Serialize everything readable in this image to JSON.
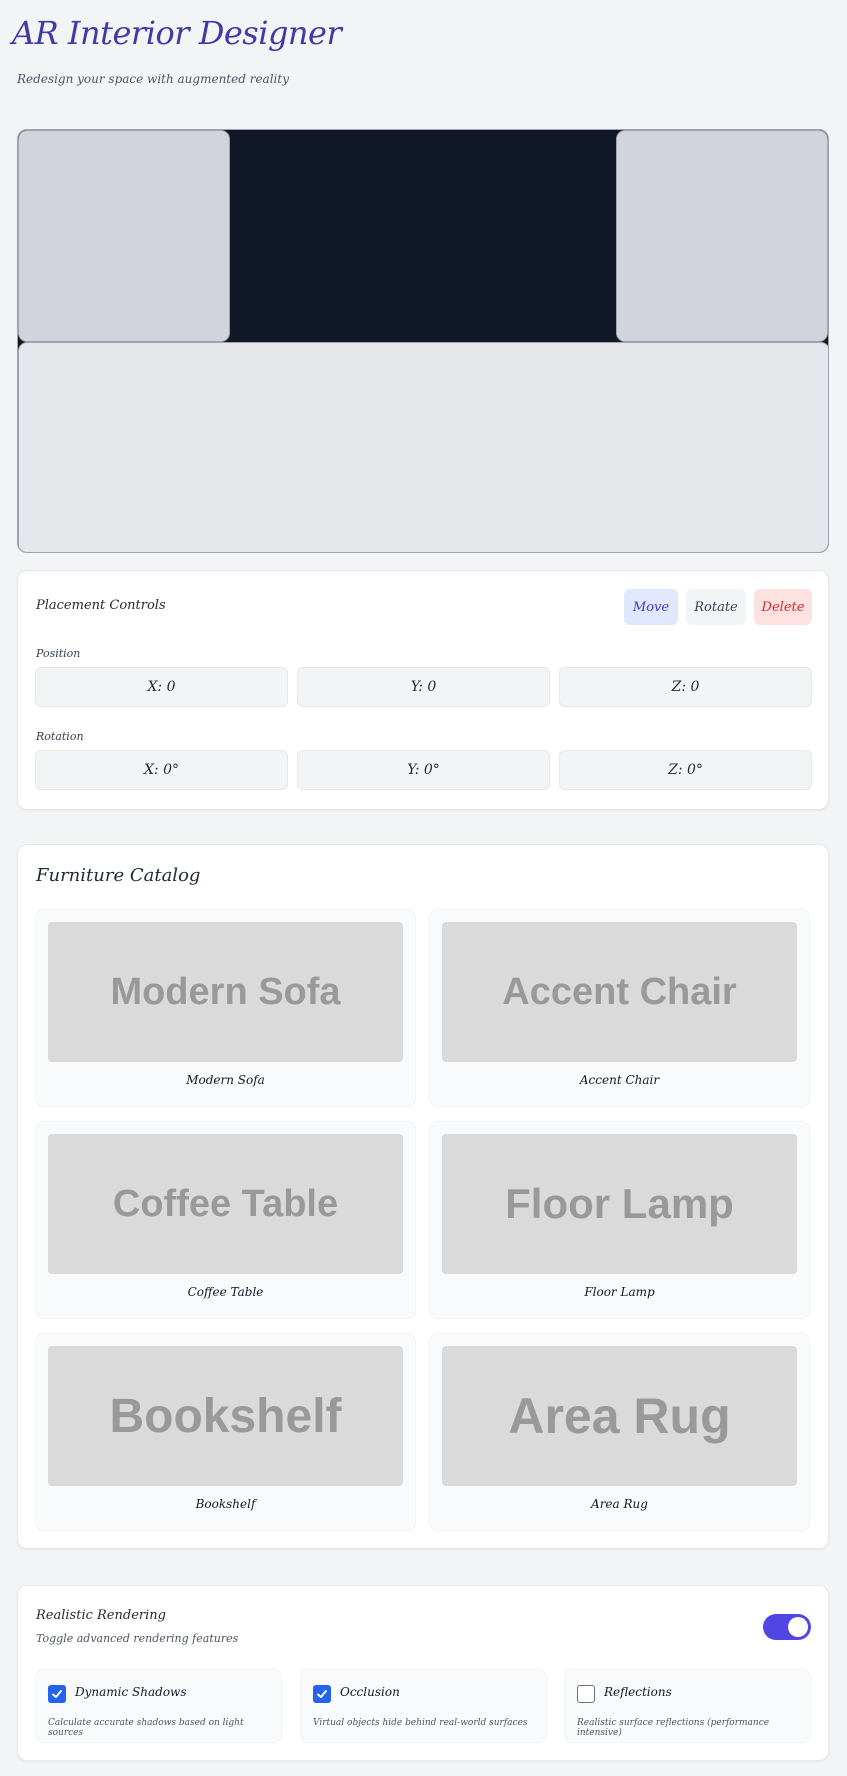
{
  "header": {
    "title": "AR Interior Designer",
    "subtitle": "Redesign your space with augmented reality"
  },
  "placement": {
    "title": "Placement Controls",
    "buttons": {
      "move": "Move",
      "rotate": "Rotate",
      "delete": "Delete"
    },
    "position_label": "Position",
    "position": [
      "X: 0",
      "Y: 0",
      "Z: 0"
    ],
    "rotation_label": "Rotation",
    "rotation": [
      "X: 0°",
      "Y: 0°",
      "Z: 0°"
    ]
  },
  "catalog": {
    "title": "Furniture Catalog",
    "items": [
      {
        "image_text": "Modern Sofa",
        "name": "Modern Sofa"
      },
      {
        "image_text": "Accent Chair",
        "name": "Accent Chair"
      },
      {
        "image_text": "Coffee Table",
        "name": "Coffee Table"
      },
      {
        "image_text": "Floor Lamp",
        "name": "Floor Lamp"
      },
      {
        "image_text": "Bookshelf",
        "name": "Bookshelf"
      },
      {
        "image_text": "Area Rug",
        "name": "Area Rug"
      }
    ]
  },
  "rendering": {
    "title": "Realistic Rendering",
    "subtitle": "Toggle advanced rendering features",
    "toggle_on": true,
    "features": [
      {
        "title": "Dynamic Shadows",
        "description": "Calculate accurate shadows based on light sources",
        "checked": true
      },
      {
        "title": "Occlusion",
        "description": "Virtual objects hide behind real-world surfaces",
        "checked": true
      },
      {
        "title": "Reflections",
        "description": "Realistic surface reflections (performance intensive)",
        "checked": false
      }
    ]
  },
  "colors": {
    "accent": "#4f46e5",
    "title": "#3f3aa8",
    "viewport_bg": "#111827",
    "checkbox": "#2563eb",
    "delete": "#dc2626"
  }
}
